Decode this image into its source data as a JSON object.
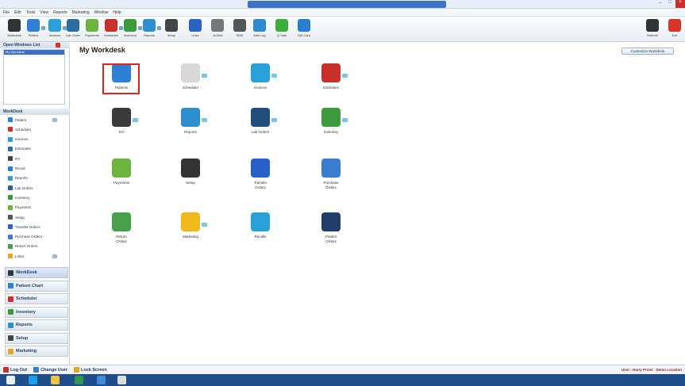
{
  "menu": [
    "File",
    "Edit",
    "Tools",
    "View",
    "Reports",
    "Marketing",
    "Window",
    "Help"
  ],
  "toolbar": {
    "items": [
      {
        "label": "Workdesk",
        "icon": "workdesk-icon",
        "color": "#333"
      },
      {
        "label": "Patient",
        "icon": "patient-icon",
        "color": "#2f7fd4"
      },
      {
        "label": "Invoices",
        "icon": "invoices-icon",
        "color": "#2aa0d8"
      },
      {
        "label": "Lab Order",
        "icon": "lab-order-icon",
        "color": "#2b6e9e"
      },
      {
        "label": "Payments",
        "icon": "payments-icon",
        "color": "#6cb33f"
      },
      {
        "label": "Scheduler",
        "icon": "scheduler-icon",
        "color": "#c9302c"
      },
      {
        "label": "Inventory",
        "icon": "inventory-icon",
        "color": "#3b9a3b"
      },
      {
        "label": "Reports",
        "icon": "reports-icon",
        "color": "#2c8fce"
      },
      {
        "label": "Setup",
        "icon": "setup-icon",
        "color": "#444"
      },
      {
        "label": "Links",
        "icon": "links-icon",
        "color": "#2a61c9"
      },
      {
        "label": "Jio'Dial",
        "icon": "clock-icon",
        "color": "#777"
      },
      {
        "label": "SMS",
        "icon": "sms-icon",
        "color": "#555"
      },
      {
        "label": "Mail Log",
        "icon": "mail-icon",
        "color": "#2b8ad0"
      },
      {
        "label": "Q Sale",
        "icon": "q-sale-icon",
        "color": "#3cae3c"
      },
      {
        "label": "Gift Card",
        "icon": "gift-card-icon",
        "color": "#2a7fcc"
      }
    ],
    "right": [
      {
        "label": "Refresh",
        "icon": "refresh-icon"
      },
      {
        "label": "Exit",
        "icon": "exit-icon"
      }
    ]
  },
  "sidebar": {
    "open_windows_title": "Open Windows List",
    "open_windows_selected": "My Workdesk",
    "workdesk_title": "WorkDesk",
    "items": [
      {
        "label": "Patient",
        "color": "#2f7fd4"
      },
      {
        "label": "Scheduler",
        "color": "#c9302c"
      },
      {
        "label": "Invoices",
        "color": "#2aa0d8"
      },
      {
        "label": "Estimates",
        "color": "#2b6e9e"
      },
      {
        "label": "RX",
        "color": "#444"
      },
      {
        "label": "Recall",
        "color": "#2a7fcc"
      },
      {
        "label": "Reports",
        "color": "#3a9ad0"
      },
      {
        "label": "Lab Orders",
        "color": "#2b5f8a"
      },
      {
        "label": "Inventory",
        "color": "#3b9a3b"
      },
      {
        "label": "Payments",
        "color": "#6cb33f"
      },
      {
        "label": "Setup",
        "color": "#555"
      },
      {
        "label": "Transfer Orders",
        "color": "#2a61c9"
      },
      {
        "label": "Purchase Orders",
        "color": "#3c7ccf"
      },
      {
        "label": "Return Orders",
        "color": "#4aa04a"
      },
      {
        "label": "Letter",
        "color": "#e0a81e"
      }
    ],
    "nav": [
      {
        "label": "WorkDesk",
        "color": "#333",
        "active": true
      },
      {
        "label": "Patient Chart",
        "color": "#2f7fd4"
      },
      {
        "label": "Scheduler",
        "color": "#c9302c"
      },
      {
        "label": "Inventory",
        "color": "#3b9a3b"
      },
      {
        "label": "Reports",
        "color": "#2c8fce"
      },
      {
        "label": "Setup",
        "color": "#444"
      },
      {
        "label": "Marketing",
        "color": "#e0a81e"
      }
    ]
  },
  "main": {
    "title": "My Workdesk",
    "customize_label": "Customize Workdesk",
    "apps": [
      {
        "label": "Patients",
        "icon": "patients-icon",
        "color": "#2f7fd4",
        "dd": false
      },
      {
        "label": "Scheduler",
        "icon": "scheduler-icon",
        "color": "#d8d8d8",
        "dd": true
      },
      {
        "label": "Invoices",
        "icon": "invoices-icon",
        "color": "#2aa0d8",
        "dd": true
      },
      {
        "label": "Estimates",
        "icon": "estimates-icon",
        "color": "#c9302c",
        "dd": true
      },
      {
        "label": "RX",
        "icon": "rx-icon",
        "color": "#3a3a3a",
        "dd": true
      },
      {
        "label": "Reports",
        "icon": "reports-icon",
        "color": "#2c8fce",
        "dd": true
      },
      {
        "label": "Lab Orders",
        "icon": "lab-orders-icon",
        "color": "#1f4f7a",
        "dd": true
      },
      {
        "label": "Inventory",
        "icon": "inventory-icon",
        "color": "#3b9a3b",
        "dd": true
      },
      {
        "label": "Payments",
        "icon": "payments-icon",
        "color": "#6cb33f",
        "dd": false
      },
      {
        "label": "Setup",
        "icon": "setup-icon",
        "color": "#333",
        "dd": false
      },
      {
        "label": "Transfer\nOrders",
        "icon": "transfer-orders-icon",
        "color": "#2a61c9",
        "dd": false
      },
      {
        "label": "Purchase\nOrders",
        "icon": "purchase-orders-icon",
        "color": "#3c7ccf",
        "dd": false
      },
      {
        "label": "Return\nOrders",
        "icon": "return-orders-icon",
        "color": "#4aa04a",
        "dd": false
      },
      {
        "label": "Marketing",
        "icon": "marketing-icon",
        "color": "#f2b81c",
        "dd": true
      },
      {
        "label": "Recalls",
        "icon": "recalls-icon",
        "color": "#2aa0d8",
        "dd": false
      },
      {
        "label": "Patient\nOrders",
        "icon": "patient-orders-icon",
        "color": "#1f3f6a",
        "dd": false
      }
    ]
  },
  "status": {
    "logout": "Log Out",
    "change_user": "Change User",
    "lock": "Lock Screen",
    "user": "User : Harry Promi",
    "location": "Demo Location"
  }
}
